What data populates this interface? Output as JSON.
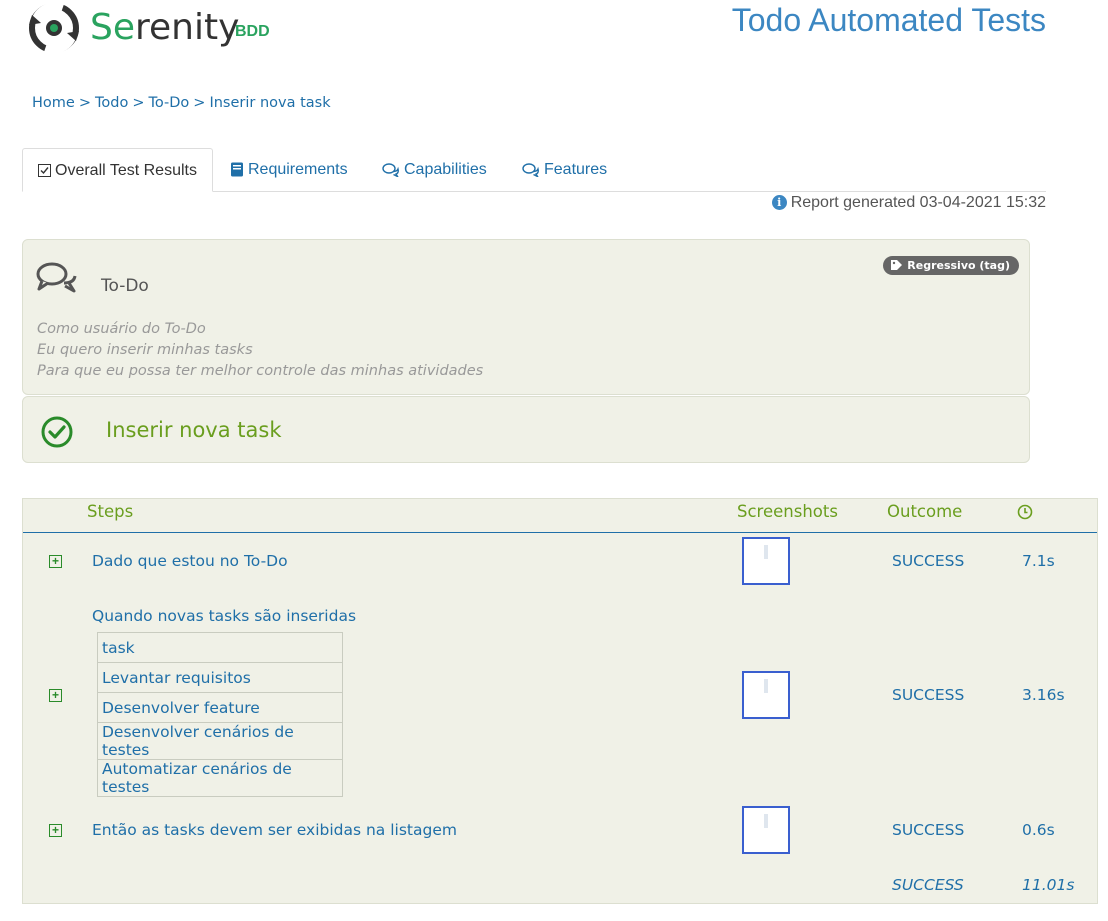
{
  "header": {
    "logo_text_se": "Se",
    "logo_text_rest": "renity",
    "logo_badge": "BDD",
    "report_title": "Todo Automated Tests"
  },
  "breadcrumb": [
    "Home",
    "Todo",
    "To-Do",
    "Inserir nova task"
  ],
  "breadcrumb_sep": ">",
  "tabs": [
    {
      "label": "Overall Test Results",
      "icon": "checkbox-icon",
      "active": true
    },
    {
      "label": "Requirements",
      "icon": "book-icon",
      "active": false
    },
    {
      "label": "Capabilities",
      "icon": "comments-icon",
      "active": false
    },
    {
      "label": "Features",
      "icon": "comments-icon",
      "active": false
    }
  ],
  "report_generated": "Report generated 03-04-2021 15:32",
  "feature": {
    "name": "To-Do",
    "tag": "Regressivo (tag)",
    "narrative": [
      "Como usuário do To-Do",
      "Eu quero inserir minhas tasks",
      "Para que eu possa ter melhor controle das minhas atividades"
    ]
  },
  "scenario": {
    "name": "Inserir nova task",
    "status_color": "#2a8b2a"
  },
  "steps_table": {
    "headers": {
      "steps": "Steps",
      "screenshots": "Screenshots",
      "outcome": "Outcome",
      "duration_icon": "clock-icon"
    },
    "rows": [
      {
        "text": "Dado que estou no To-Do",
        "outcome": "SUCCESS",
        "duration": "7.1s"
      },
      {
        "text": "Quando novas tasks são inseridas",
        "outcome": "SUCCESS",
        "duration": "3.16s",
        "data_table": [
          "task",
          "Levantar requisitos",
          "Desenvolver feature",
          "Desenvolver cenários de testes",
          "Automatizar cenários de testes"
        ]
      },
      {
        "text": "Então as tasks devem ser exibidas na listagem",
        "outcome": "SUCCESS",
        "duration": "0.6s"
      }
    ],
    "total": {
      "outcome": "SUCCESS",
      "duration": "11.01s"
    }
  },
  "colors": {
    "link": "#1f6fa8",
    "success": "#6a9e1e",
    "brand": "#2aa35f",
    "title": "#3c87c2"
  }
}
